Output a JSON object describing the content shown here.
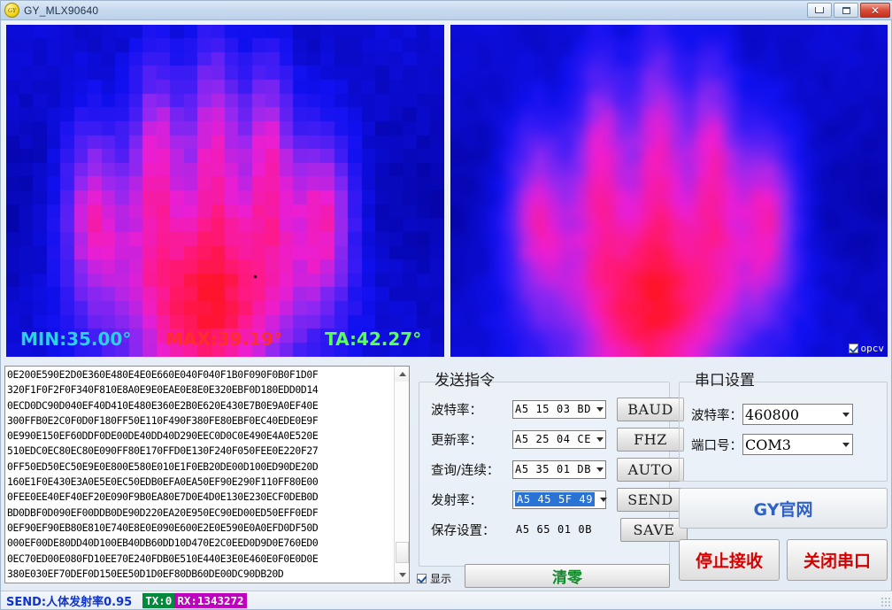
{
  "window": {
    "title": "GY_MLX90640",
    "icon": "app-icon",
    "minimize_label": "",
    "maximize_label": "",
    "close_label": "✕"
  },
  "thermal": {
    "min_label": "MIN:35.00°",
    "max_label": "MAX:39.19°",
    "ta_label": "TA:42.27°",
    "min_color": "#2ad2e8",
    "max_color": "#ff2d2d",
    "ta_color": "#5bff5b",
    "opcv_label": "opcv",
    "opcv_checked": true,
    "min_value": 35.0,
    "max_value": 39.19,
    "ta_value": 42.27
  },
  "log": {
    "lines": [
      "0E200E590E2D0E360E480E4E0E660E040F040F1B0F090F0B0F1D0F",
      "320F1F0F2F0F340F810E8A0E9E0EAE0E8E0E320EBF0D180EDD0D14",
      "0ECD0DC90D040EF40D410E480E360E2B0E620E430E7B0E9A0EF40E",
      "300FFB0E2C0F0D0F180FF50E110F490F380FE80EBF0EC40EDE0E9F",
      "0E990E150EF60DDF0DE00DE40DD40D290EEC0D0C0E490E4A0E520E",
      "510EDC0EC80EC80E090FF80E170FFD0E130F240F050FEE0E220F27",
      "0FF50ED50EC50E9E0E800E580E010E1F0EB20DE00D100ED90DE20D",
      "160E1F0E430E3A0E5E0EC50EDB0EFA0EA50EF90E290F110FF80E00",
      "0FEE0EE40EF40EF20E090F9B0EA80E7D0E4D0E130E230ECF0DEB0D",
      "BD0DBF0D090EF00DDB0DE90D220EA20E950EC90ED00ED50EFF0EDF",
      "0EF90EF90EB80E810E740E8E0E090E600E2E0E590E0A0EFD0DF50D",
      "000EF00DE80DD40D100EB40DB60DD10D470E2C0EED0D9D0E760ED0",
      "0EC70ED00E080FD10EE70E240FDB0E510E440E3E0E460E0F0E0D0E",
      "380E030EF70DEF0D150EE50D1D0EF80DB60DE00DC90DB20D"
    ]
  },
  "send_commands": {
    "title": "发送指令",
    "rows": [
      {
        "label": "波特率：",
        "value": "A5 15 03 BD",
        "button": "BAUD",
        "type": "combo",
        "selected": false
      },
      {
        "label": "更新率：",
        "value": "A5 25 04 CE",
        "button": "FHZ",
        "type": "combo",
        "selected": false
      },
      {
        "label": "查询/连续：",
        "value": "A5 35 01 DB",
        "button": "AUTO",
        "type": "combo",
        "selected": false
      },
      {
        "label": "发射率：",
        "value": "A5 45 5F 49",
        "button": "SEND",
        "type": "combo",
        "selected": true
      },
      {
        "label": "保存设置：",
        "value": "A5 65 01 0B",
        "button": "SAVE",
        "type": "text",
        "selected": false
      }
    ]
  },
  "serial_settings": {
    "title": "串口设置",
    "baud_label": "波特率：",
    "baud_value": "460800",
    "port_label": "端口号：",
    "port_value": "COM3",
    "website_button": "GY官网",
    "stop_button": "停止接收",
    "close_port_button": "关闭串口"
  },
  "bottom_controls": {
    "show_label": "显示",
    "show_checked": true,
    "clear_button": "清零"
  },
  "statusbar": {
    "send_text": "SEND:人体发射率0.95",
    "tx_text": "TX:0",
    "rx_text": "RX:1343272",
    "tx_color": "#008a3c",
    "rx_color": "#bf00bf",
    "send_color": "#1033c8"
  }
}
